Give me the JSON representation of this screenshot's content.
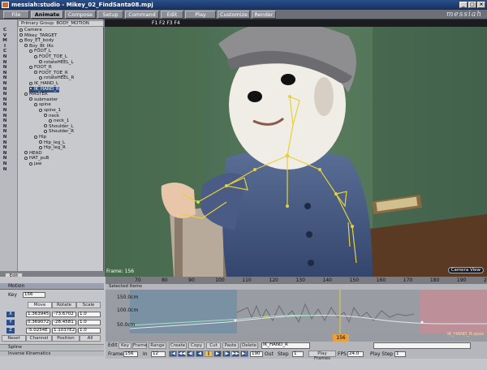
{
  "window": {
    "title": "messiah:studio - Mikey_02_FindSanta08.mpj",
    "minimize": "_",
    "maximize": "□",
    "close": "×"
  },
  "menu": {
    "tabs": [
      "File",
      "Animate",
      "Compose",
      "Setup",
      "Command",
      "Edit",
      "Play",
      "Customize",
      "Render"
    ],
    "active": "Animate",
    "brand": "messiah"
  },
  "hierarchy": {
    "group_label": "Primary Group: BODY_MOTION",
    "flags": [
      "C",
      "V",
      "M",
      "I",
      "C",
      "N",
      "N",
      "N",
      "N",
      "N",
      "N",
      "N",
      "N",
      "N",
      "N",
      "N",
      "N",
      "N",
      "N",
      "N",
      "N",
      "N",
      "N",
      "N",
      "N",
      "N",
      "N"
    ],
    "items": [
      {
        "label": "Camera",
        "indent": 0
      },
      {
        "label": "Mikey_TARGET",
        "indent": 0
      },
      {
        "label": "Boy_ET_body",
        "indent": 0
      },
      {
        "label": "Boy_Bt_IKs",
        "indent": 1
      },
      {
        "label": "FOOT_L",
        "indent": 2
      },
      {
        "label": "FOOT_TOE_L",
        "indent": 3
      },
      {
        "label": "rotateHEEL_L",
        "indent": 4
      },
      {
        "label": "FOOT_R",
        "indent": 2
      },
      {
        "label": "FOOT_TOE_R",
        "indent": 3
      },
      {
        "label": "rotateHEEL_R",
        "indent": 4
      },
      {
        "label": "IK_HAND_L",
        "indent": 2
      },
      {
        "label": "IK_HAND_R",
        "indent": 2,
        "selected": true
      },
      {
        "label": "MASTER",
        "indent": 1
      },
      {
        "label": "submaster",
        "indent": 2
      },
      {
        "label": "spine",
        "indent": 3
      },
      {
        "label": "spine_1",
        "indent": 4
      },
      {
        "label": "neck",
        "indent": 5
      },
      {
        "label": "neck_1",
        "indent": 6
      },
      {
        "label": "Shoulder_L",
        "indent": 5
      },
      {
        "label": "Shoulder_R",
        "indent": 5
      },
      {
        "label": "Hip",
        "indent": 3
      },
      {
        "label": "Hip_leg_L",
        "indent": 4
      },
      {
        "label": "Hip_leg_R",
        "indent": 4
      },
      {
        "label": "HEAD",
        "indent": 1
      },
      {
        "label": "HAT_puB",
        "indent": 1
      },
      {
        "label": "jaw",
        "indent": 2
      }
    ],
    "edit_label": "Edit"
  },
  "viewport": {
    "toolbar": "F1 F2 F3 F4",
    "frame_label": "Frame: 156",
    "camera": "Camera View"
  },
  "motion": {
    "header": "Motion",
    "key_label": "Key",
    "key_value": "156",
    "tabs": [
      "Move",
      "Rotate",
      "Scale"
    ],
    "rows": [
      {
        "axis": "X",
        "move": "1.363945",
        "rotate": "-73.6702",
        "scale": "1.0"
      },
      {
        "axis": "Y",
        "move": "0.369072",
        "rotate": "-28.4581",
        "scale": "1.0"
      },
      {
        "axis": "Z",
        "move": "-5.0254E",
        "rotate": "1.1037E2",
        "scale": "1.0"
      }
    ],
    "buttons": [
      "Reset",
      "Channel",
      "Position",
      "All"
    ],
    "sections": [
      "Spline",
      "Inverse Kinematics"
    ]
  },
  "timeline": {
    "ticks": [
      "70",
      "80",
      "90",
      "100",
      "110",
      "120",
      "130",
      "140",
      "150",
      "160",
      "170",
      "180",
      "190",
      "200"
    ],
    "selected_items": "Selected Items",
    "yaxis": [
      "150.0cm",
      "100.0cm",
      "50.0cm"
    ],
    "curve_label": "IK_HAND_R.spos",
    "current_frame": "156"
  },
  "controls": {
    "row1": [
      "Edit",
      "Key",
      "Frame",
      "Range",
      "Create",
      "Copy",
      "Cut",
      "Paste",
      "Delete"
    ],
    "item_select": "IK_HAND_R",
    "frame_label": "Frame",
    "frame_value": "156",
    "in_label": "In",
    "in_value": "12",
    "out_value": "190",
    "out_label": "Out",
    "step_label": "Step",
    "step_value": "1",
    "play_frames": "Play Frames",
    "fps_label": "FPS",
    "fps_value": "24.0",
    "play_step_label": "Play Step",
    "play_step_value": "1"
  },
  "colors": {
    "accent": "#2d4f86",
    "bone": "#e5d23a",
    "curve": "#e0e0e0"
  }
}
